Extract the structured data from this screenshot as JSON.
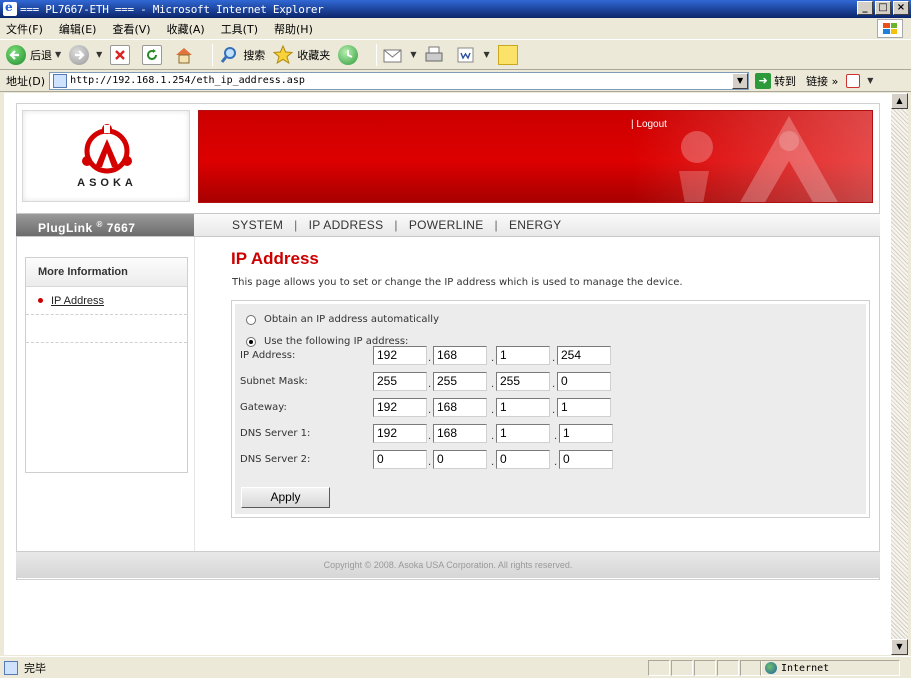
{
  "window": {
    "title": "=== PL7667-ETH === - Microsoft Internet Explorer",
    "buttons": [
      "_",
      "□",
      "×"
    ]
  },
  "menubar": [
    "文件(F)",
    "编辑(E)",
    "查看(V)",
    "收藏(A)",
    "工具(T)",
    "帮助(H)"
  ],
  "toolbar": {
    "back": "后退",
    "search": "搜索",
    "favorites": "收藏夹"
  },
  "addressbar": {
    "label": "地址(D)",
    "url": "http://192.168.1.254/eth_ip_address.asp",
    "go": "转到",
    "links": "链接"
  },
  "header": {
    "logo_text": "ASOKA",
    "logout": "| Logout"
  },
  "nav": {
    "brand": "PlugLink",
    "brand_sup": "®",
    "brand_model": "7667",
    "items": [
      "SYSTEM",
      "IP ADDRESS",
      "POWERLINE",
      "ENERGY"
    ]
  },
  "sidebar": {
    "title": "More Information",
    "items": [
      "IP Address"
    ]
  },
  "main": {
    "title": "IP Address",
    "description": "This page allows you to set or change the IP address which is used to manage the device.",
    "radio_auto": "Obtain an IP address automatically",
    "radio_manual": "Use the following IP address:",
    "selected": "manual",
    "fields": [
      {
        "label": "IP Address:",
        "octets": [
          "192",
          "168",
          "1",
          "254"
        ]
      },
      {
        "label": "Subnet Mask:",
        "octets": [
          "255",
          "255",
          "255",
          "0"
        ]
      },
      {
        "label": "Gateway:",
        "octets": [
          "192",
          "168",
          "1",
          "1"
        ]
      },
      {
        "label": "DNS Server 1:",
        "octets": [
          "192",
          "168",
          "1",
          "1"
        ]
      },
      {
        "label": "DNS Server 2:",
        "octets": [
          "0",
          "0",
          "0",
          "0"
        ]
      }
    ],
    "apply": "Apply"
  },
  "footer": "Copyright © 2008. Asoka USA Corporation. All rights reserved.",
  "status": {
    "text": "完毕",
    "zone": "Internet"
  },
  "colors": {
    "brand_red": "#cc0000",
    "title_bar": "#0a246a"
  }
}
